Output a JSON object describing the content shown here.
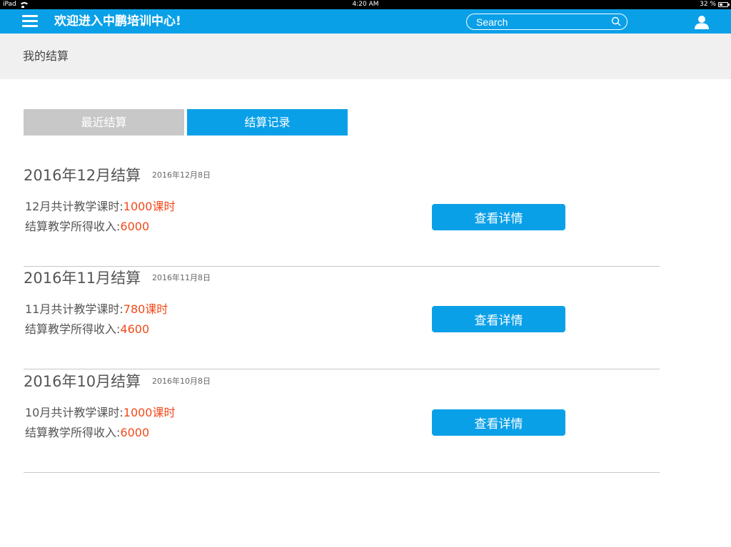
{
  "status_bar": {
    "device": "iPad",
    "time": "4:20 AM",
    "battery": "32 %"
  },
  "header": {
    "title": "欢迎进入中鹏培训中心!",
    "search_placeholder": "Search"
  },
  "page": {
    "title": "我的结算"
  },
  "tabs": [
    {
      "label": "最近结算",
      "active": false
    },
    {
      "label": "结算记录",
      "active": true
    }
  ],
  "records": [
    {
      "title": "2016年12月结算",
      "date": "2016年12月8日",
      "hours_label": "12月共计教学课时:",
      "hours_value": "1000课时",
      "income_label": "结算教学所得收入:",
      "income_value": "6000",
      "button": "查看详情"
    },
    {
      "title": "2016年11月结算",
      "date": "2016年11月8日",
      "hours_label": "11月共计教学课时:",
      "hours_value": "780课时",
      "income_label": "结算教学所得收入:",
      "income_value": "4600",
      "button": "查看详情"
    },
    {
      "title": "2016年10月结算",
      "date": "2016年10月8日",
      "hours_label": "10月共计教学课时:",
      "hours_value": "1000课时",
      "income_label": "结算教学所得收入:",
      "income_value": "6000",
      "button": "查看详情"
    }
  ],
  "colors": {
    "accent": "#0aa0e8",
    "highlight": "#f24a1a",
    "tab_inactive": "#c8c8c8",
    "band": "#f0f0f0"
  },
  "icons": {
    "menu": "hamburger-menu-icon",
    "search": "search-icon",
    "user": "user-icon",
    "wifi": "wifi-icon",
    "battery": "battery-icon"
  }
}
